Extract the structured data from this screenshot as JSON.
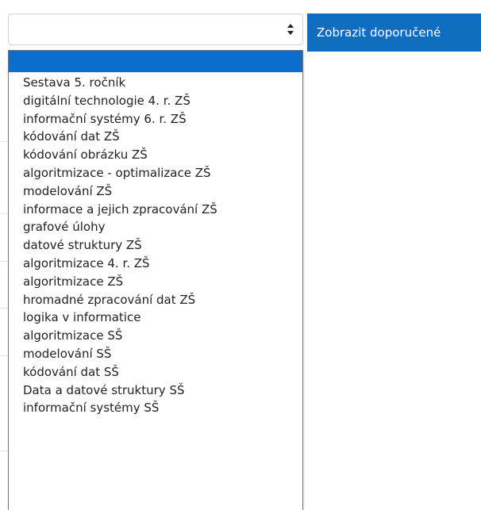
{
  "select": {
    "value": "",
    "arrow_icon": "sort-arrows-icon"
  },
  "submit_button": {
    "label": "Zobrazit doporučené"
  },
  "colors": {
    "accent": "#0f6cbf",
    "selected_option": "#0a6ecf"
  },
  "dropdown": {
    "selected_option_label": "",
    "options": [
      "Sestava 5. ročník",
      "digitální technologie 4. r. ZŠ",
      "informační systémy 6. r. ZŠ",
      "kódování dat ZŠ",
      "kódování obrázku ZŠ",
      "algoritmizace - optimalizace ZŠ",
      "modelování ZŠ",
      "informace a jejich zpracování ZŠ",
      "grafové úlohy",
      "datové struktury ZŠ",
      "algoritmizace 4. r. ZŠ",
      "algoritmizace ZŠ",
      "hromadné zpracování dat ZŠ",
      "logika v informatice",
      "algoritmizace SŠ",
      "modelování SŠ",
      "kódování dat SŠ",
      "Data a datové struktury SŠ",
      "informační systémy SŠ"
    ]
  }
}
